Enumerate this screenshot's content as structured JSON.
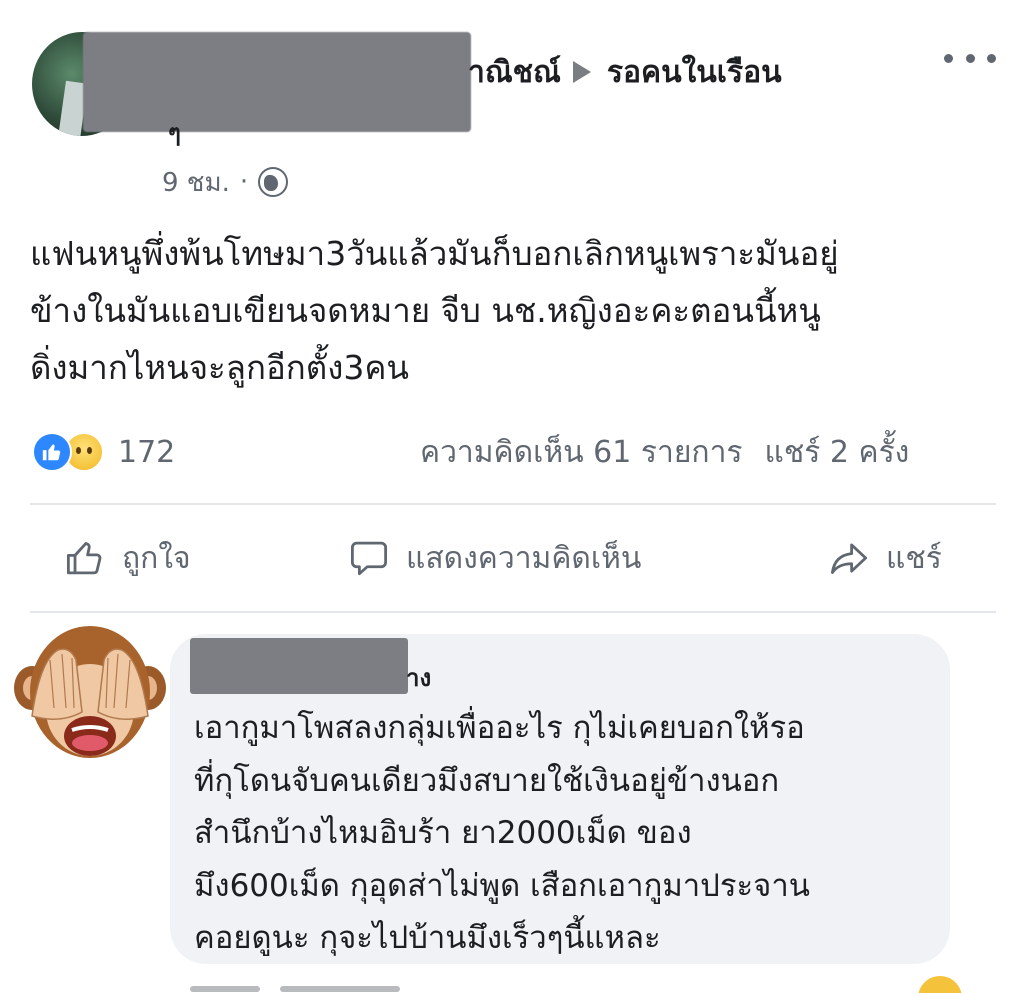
{
  "header": {
    "group_partial": "าณิชณ์",
    "group_name": "รอคนในเรือน",
    "name_tail": "ๆ",
    "time": "9 ชม.",
    "separator": "·"
  },
  "post": {
    "lines": [
      "แฟนหนูพึ่งพ้นโทษมา3วันแล้วมันก็บอกเลิกหนูเพราะมันอยู่",
      "ข้างในมันแอบเขียนจดหมาย จีบ นช.หญิงอะคะตอนนี้หนู",
      "ดิ่งมากไหนจะลูกอีกตั้ง3คน"
    ]
  },
  "stats": {
    "reaction_count": "172",
    "comments": "ความคิดเห็น 61 รายการ",
    "shares": "แชร์ 2 ครั้ง"
  },
  "actions": {
    "like": "ถูกใจ",
    "comment": "แสดงความคิดเห็น",
    "share": "แชร์"
  },
  "comment": {
    "name_tail": "าง",
    "lines": [
      "เอากูมาโพสลงกลุ่มเพื่ออะไร กุไม่เคยบอกให้รอ",
      "ที่กุโดนจับคนเดียวมึงสบายใช้เงินอยู่ข้างนอก",
      "สำนึกบ้างไหมอิบร้า ยา2000เม็ด ของ",
      "มึง600เม็ด กุอุดส่าไม่พูด เสือกเอากูมาประจาน",
      "คอยดูนะ กุจะไปบ้านมึงเร็วๆนี้แหละ"
    ]
  },
  "colors": {
    "text": "#1c1e21",
    "secondary_text": "#606770",
    "like_blue": "#2d88ff",
    "bubble_bg": "#f0f2f5",
    "redaction": "#7d7d84"
  },
  "icons": {
    "more": "more-dots-icon",
    "globe": "globe-icon",
    "like_reaction": "like-reaction-icon",
    "sad_reaction": "sad-reaction-icon",
    "thumbs_up": "thumbs-up-icon",
    "comment": "comment-bubble-icon",
    "share": "share-arrow-icon",
    "monkey": "see-no-evil-monkey-icon"
  }
}
